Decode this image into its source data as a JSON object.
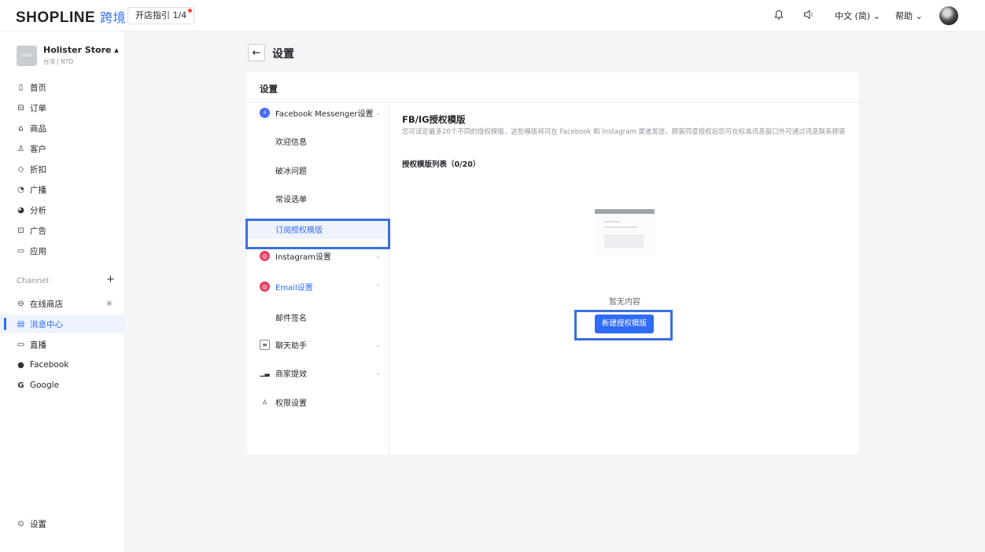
{
  "topbar": {
    "brand": "SHOPLINE",
    "brand_sub": "跨境",
    "guide": "开店指引 1/4",
    "language": "中文 (简) ⌄",
    "help": "帮助 ⌄"
  },
  "sidebar": {
    "store_logo": "LOGO",
    "store_name": "Holister Store ▴",
    "store_sub": "台湾 | NTD",
    "items": [
      {
        "label": "首页",
        "icon": "dashboard-icon"
      },
      {
        "label": "订单",
        "icon": "order-icon"
      },
      {
        "label": "商品",
        "icon": "bag-icon"
      },
      {
        "label": "客户",
        "icon": "user-icon"
      },
      {
        "label": "折扣",
        "icon": "tag-icon"
      },
      {
        "label": "广播",
        "icon": "broadcast-icon"
      },
      {
        "label": "分析",
        "icon": "analytics-icon"
      },
      {
        "label": "广告",
        "icon": "ad-icon"
      },
      {
        "label": "应用",
        "icon": "apps-icon"
      }
    ],
    "channel_label": "Channel",
    "channel_add": "+",
    "channels": [
      {
        "label": "在线商店",
        "icon": "store-icon"
      },
      {
        "label": "消息中心",
        "icon": "message-icon",
        "active": true
      },
      {
        "label": "直播",
        "icon": "live-icon"
      },
      {
        "label": "Facebook",
        "icon": "facebook-icon"
      },
      {
        "label": "Google",
        "icon": "google-icon"
      }
    ],
    "settings": "设置"
  },
  "main": {
    "page_title": "设置",
    "card_title": "设置",
    "menu": {
      "fb_messenger": "Facebook Messenger设置",
      "welcome": "欢迎信息",
      "icebreaker": "破冰问题",
      "persistent_menu": "常设选单",
      "subscription_template": "订阅授权模版",
      "instagram": "Instagram设置",
      "email": "Email设置",
      "email_signature": "邮件签名",
      "chat_assistant": "聊天助手",
      "merchant_efficiency": "商家提效",
      "permissions": "权限设置"
    },
    "content": {
      "title": "FB/IG授权模版",
      "description": "您可设定最多20个不同的授权模版，这些模版将可在 Facebook 和 Instagram 渠道发送，顾客同意授权后您可在标准讯息窗口外可通过讯息联系顾客",
      "list_title": "授权模版列表（0/20）",
      "empty_text": "暂无内容",
      "new_button": "新建授权模版"
    }
  },
  "colors": {
    "accent": "#2f6cf6",
    "highlight_box": "#3b6fe0",
    "notification_dot": "#f53f3f"
  }
}
